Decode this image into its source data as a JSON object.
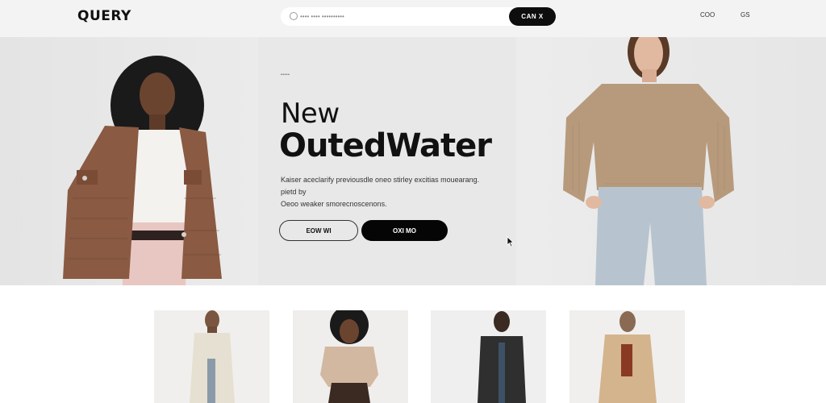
{
  "header": {
    "logo": "QUERY",
    "search": {
      "placeholder": "•••• •••• ••••••••••"
    },
    "search_button": "CAN X",
    "nav": [
      "COO",
      "GS"
    ]
  },
  "hero": {
    "eyebrow": "•••••",
    "title_line1": "New",
    "title_line2": "OutedWater",
    "description_line1": "Kaiser aceclarify previousdle oneo stirley excitias mouearang. pietd by",
    "description_line2": "Oeoo weaker smorecnoscenons.",
    "button_outline": "EOW WI",
    "button_solid": "OXI MO"
  },
  "products": [
    {
      "name": "product-1"
    },
    {
      "name": "product-2"
    },
    {
      "name": "product-3"
    },
    {
      "name": "product-4"
    }
  ],
  "colors": {
    "accent": "#050505",
    "header_bg": "#f3f3f3",
    "hero_bg": "#e8e8e8"
  }
}
